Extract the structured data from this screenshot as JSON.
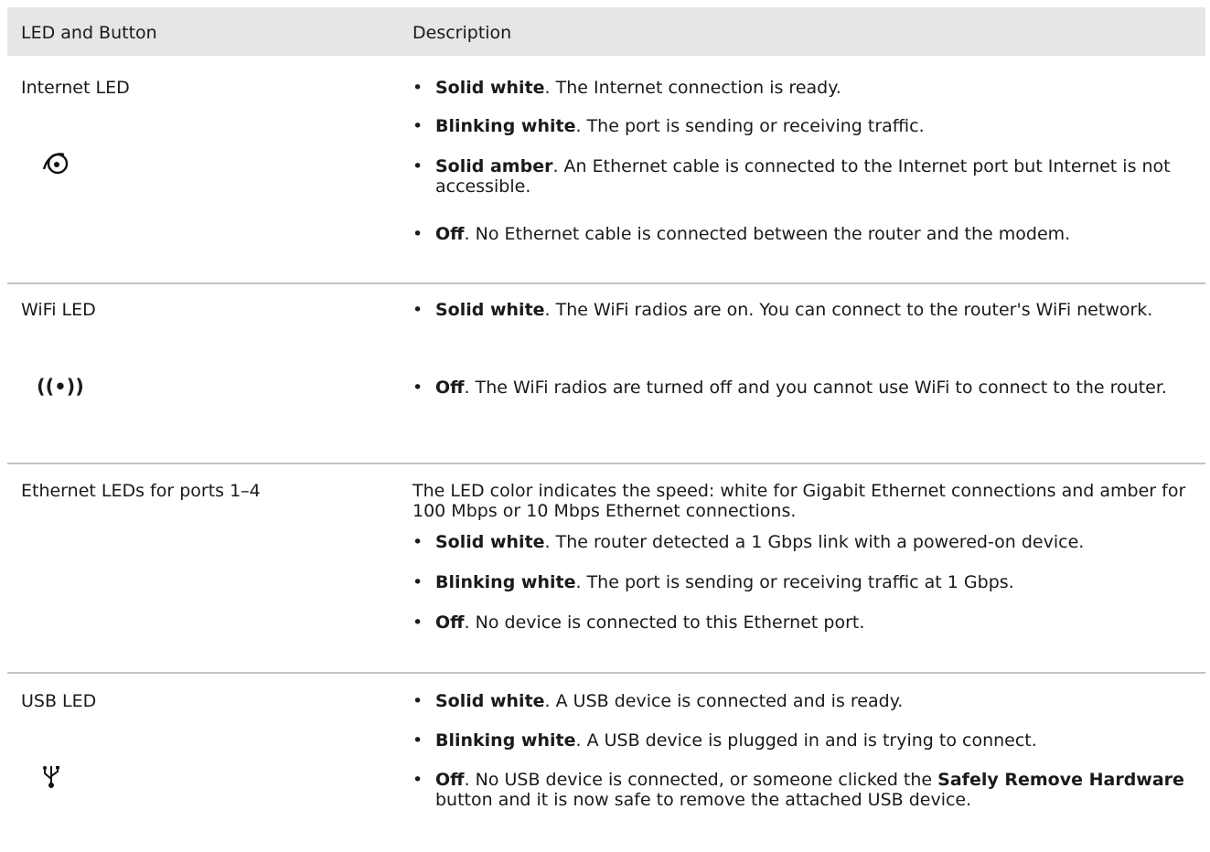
{
  "header": {
    "col1": "LED and Button",
    "col2": "Description"
  },
  "rows": [
    {
      "name": "Internet LED",
      "icon": "internet-globe-icon",
      "bullets": [
        {
          "bold": "Solid white",
          "text": ". The Internet connection is ready."
        },
        {
          "bold": "Blinking white",
          "text": ". The port is sending or receiving traffic."
        },
        {
          "bold": "Solid amber",
          "text": ". An Ethernet cable is connected to the Internet port but Internet is not accessible."
        },
        {
          "bold": "Off",
          "text": ". No Ethernet cable is connected between the router and the modem."
        }
      ]
    },
    {
      "name": "WiFi LED",
      "icon": "wifi-icon",
      "bullets": [
        {
          "bold": "Solid white",
          "text": ". The WiFi radios are on. You can connect to the router's WiFi network."
        },
        {
          "bold": "Off",
          "text": ". The WiFi radios are turned off and you cannot use WiFi to connect to the router."
        }
      ]
    },
    {
      "name": "Ethernet LEDs for ports 1–4",
      "intro": "The LED color indicates the speed: white for Gigabit Ethernet connections and amber for 100 Mbps or 10 Mbps Ethernet connections.",
      "bullets": [
        {
          "bold": "Solid white",
          "text": ". The router detected a 1 Gbps link with a powered-on device."
        },
        {
          "bold": "Blinking white",
          "text": ". The port is sending or receiving traffic at 1 Gbps."
        },
        {
          "bold": "Off",
          "text": ". No device is connected to this Ethernet port."
        }
      ]
    },
    {
      "name": "USB LED",
      "icon": "usb-icon",
      "bullets": [
        {
          "bold": "Solid white",
          "text": ". A USB device is connected and is ready."
        },
        {
          "bold": "Blinking white",
          "text": ". A USB device is plugged in and is trying to connect."
        },
        {
          "bold": "Off",
          "text": ". No USB device is connected, or someone clicked the ",
          "bold2": "Safely Remove Hardware",
          "text2": " button and it is now safe to remove the attached USB device."
        }
      ]
    }
  ]
}
